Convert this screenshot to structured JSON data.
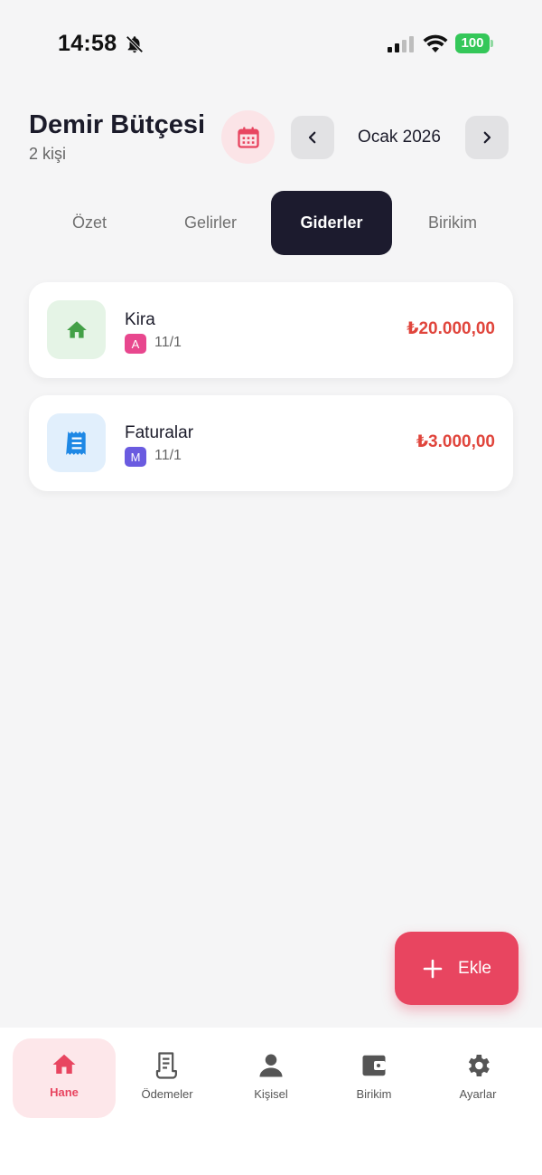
{
  "status_bar": {
    "time": "14:58",
    "battery": "100"
  },
  "header": {
    "title": "Demir Bütçesi",
    "subtitle": "2 kişi",
    "month": "Ocak 2026"
  },
  "tabs": [
    {
      "label": "Özet"
    },
    {
      "label": "Gelirler"
    },
    {
      "label": "Giderler",
      "active": true
    },
    {
      "label": "Birikim"
    }
  ],
  "expenses": [
    {
      "name": "Kira",
      "badge": "A",
      "badge_color": "#e8478e",
      "date": "11/1",
      "amount": "₺20.000,00",
      "icon": "home-icon",
      "icon_bg": "#e5f4e6",
      "icon_color": "#43a047"
    },
    {
      "name": "Faturalar",
      "badge": "M",
      "badge_color": "#6a5be0",
      "date": "11/1",
      "amount": "₺3.000,00",
      "icon": "receipt-icon",
      "icon_bg": "#e1effc",
      "icon_color": "#1e88e5"
    }
  ],
  "fab": {
    "label": "Ekle"
  },
  "bottom_nav": [
    {
      "label": "Hane",
      "icon": "home-icon",
      "active": true
    },
    {
      "label": "Ödemeler",
      "icon": "receipt-icon"
    },
    {
      "label": "Kişisel",
      "icon": "person-icon"
    },
    {
      "label": "Birikim",
      "icon": "wallet-icon"
    },
    {
      "label": "Ayarlar",
      "icon": "gear-icon"
    }
  ],
  "colors": {
    "accent": "#e84560",
    "expense": "#e0453c",
    "dark": "#1c1b2e"
  }
}
